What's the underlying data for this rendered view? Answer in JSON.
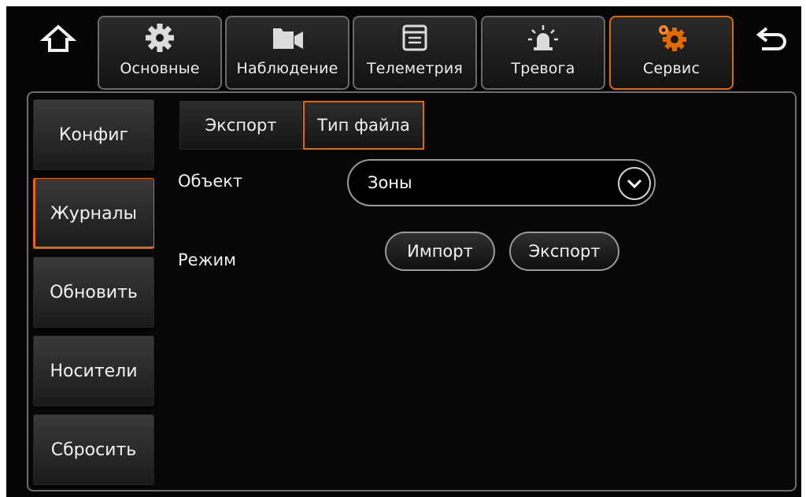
{
  "topbar": {
    "tabs": [
      {
        "label": "Основные",
        "icon": "gear-icon"
      },
      {
        "label": "Наблюдение",
        "icon": "video-camera-icon"
      },
      {
        "label": "Телеметрия",
        "icon": "window-list-icon"
      },
      {
        "label": "Тревога",
        "icon": "alarm-siren-icon"
      },
      {
        "label": "Сервис",
        "icon": "gears-service-icon"
      }
    ],
    "active_tab": "Сервис"
  },
  "sidebar": {
    "items": [
      {
        "label": "Конфиг"
      },
      {
        "label": "Журналы"
      },
      {
        "label": "Обновить"
      },
      {
        "label": "Носители"
      },
      {
        "label": "Сбросить"
      }
    ],
    "active_item": "Журналы"
  },
  "subtabs": {
    "items": [
      {
        "label": "Экспорт"
      },
      {
        "label": "Тип файла"
      }
    ],
    "active": "Тип файла"
  },
  "form": {
    "object_label": "Объект",
    "object_value": "Зоны",
    "mode_label": "Режим",
    "import_label": "Импорт",
    "export_label": "Экспорт"
  },
  "colors": {
    "accent": "#e36a00",
    "background": "#050505"
  }
}
